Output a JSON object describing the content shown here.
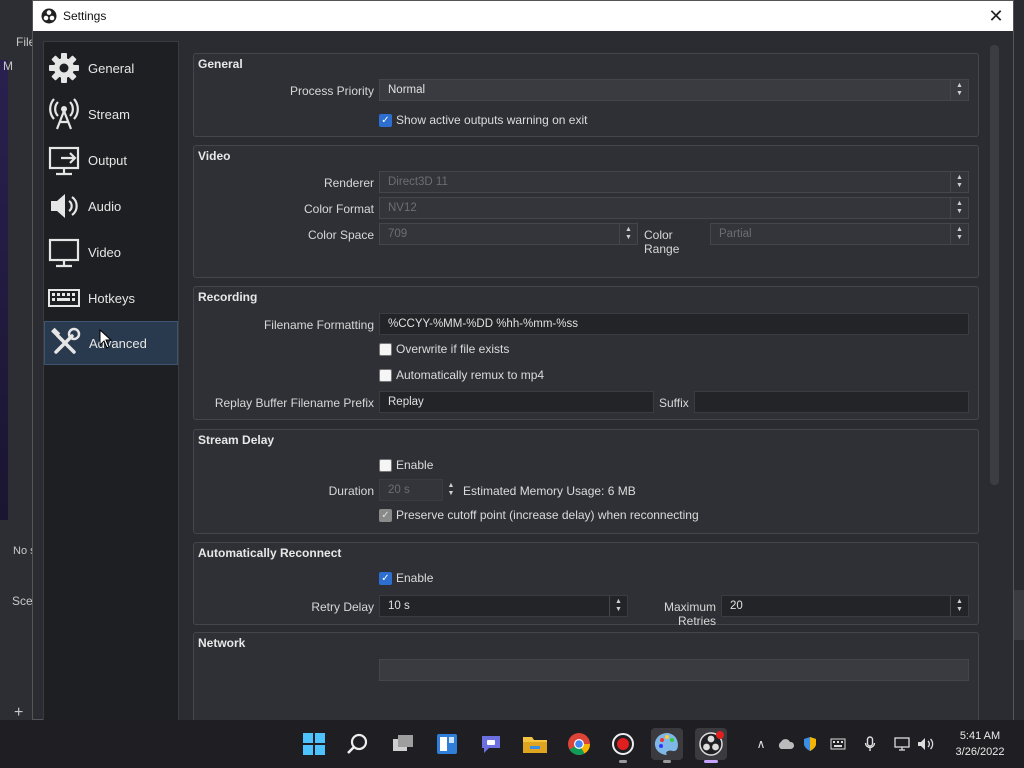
{
  "window": {
    "title": "Settings"
  },
  "background_app": {
    "menu_file": "File",
    "menu_frag": "M",
    "no_source": "No s",
    "scenes": "Scen",
    "plus": "+"
  },
  "sidebar": {
    "items": [
      {
        "label": "General",
        "icon": "gear-icon"
      },
      {
        "label": "Stream",
        "icon": "broadcast-antenna-icon"
      },
      {
        "label": "Output",
        "icon": "output-monitor-icon"
      },
      {
        "label": "Audio",
        "icon": "speaker-icon"
      },
      {
        "label": "Video",
        "icon": "monitor-icon"
      },
      {
        "label": "Hotkeys",
        "icon": "keyboard-icon"
      },
      {
        "label": "Advanced",
        "icon": "tools-icon",
        "active": true
      }
    ]
  },
  "general": {
    "title": "General",
    "process_priority_label": "Process Priority",
    "process_priority_value": "Normal",
    "show_warning_label": "Show active outputs warning on exit",
    "show_warning_checked": true
  },
  "video": {
    "title": "Video",
    "renderer_label": "Renderer",
    "renderer_value": "Direct3D 11",
    "color_format_label": "Color Format",
    "color_format_value": "NV12",
    "color_space_label": "Color Space",
    "color_space_value": "709",
    "color_range_label": "Color Range",
    "color_range_value": "Partial"
  },
  "recording": {
    "title": "Recording",
    "filename_label": "Filename Formatting",
    "filename_value": "%CCYY-%MM-%DD %hh-%mm-%ss",
    "overwrite_label": "Overwrite if file exists",
    "overwrite_checked": false,
    "remux_label": "Automatically remux to mp4",
    "remux_checked": false,
    "replay_prefix_label": "Replay Buffer Filename Prefix",
    "replay_prefix_value": "Replay",
    "suffix_label": "Suffix",
    "suffix_value": ""
  },
  "stream_delay": {
    "title": "Stream Delay",
    "enable_label": "Enable",
    "enable_checked": false,
    "duration_label": "Duration",
    "duration_value": "20 s",
    "memory_usage": "Estimated Memory Usage: 6 MB",
    "preserve_label": "Preserve cutoff point (increase delay) when reconnecting",
    "preserve_checked": true
  },
  "reconnect": {
    "title": "Automatically Reconnect",
    "enable_label": "Enable",
    "enable_checked": true,
    "retry_delay_label": "Retry Delay",
    "retry_delay_value": "10 s",
    "max_retries_label": "Maximum Retries",
    "max_retries_value": "20"
  },
  "network": {
    "title": "Network"
  },
  "taskbar": {
    "apps": [
      "windows-start-icon",
      "search-icon",
      "task-view-icon",
      "widgets-icon",
      "teams-chat-icon",
      "file-explorer-icon",
      "chrome-icon",
      "record-icon",
      "paint-icon",
      "obs-icon"
    ],
    "time": "5:41 AM",
    "date": "3/26/2022"
  },
  "colors": {
    "accent": "#2d6fd1",
    "active_nav": "#2a3a4e",
    "panel": "#2b2c31"
  }
}
